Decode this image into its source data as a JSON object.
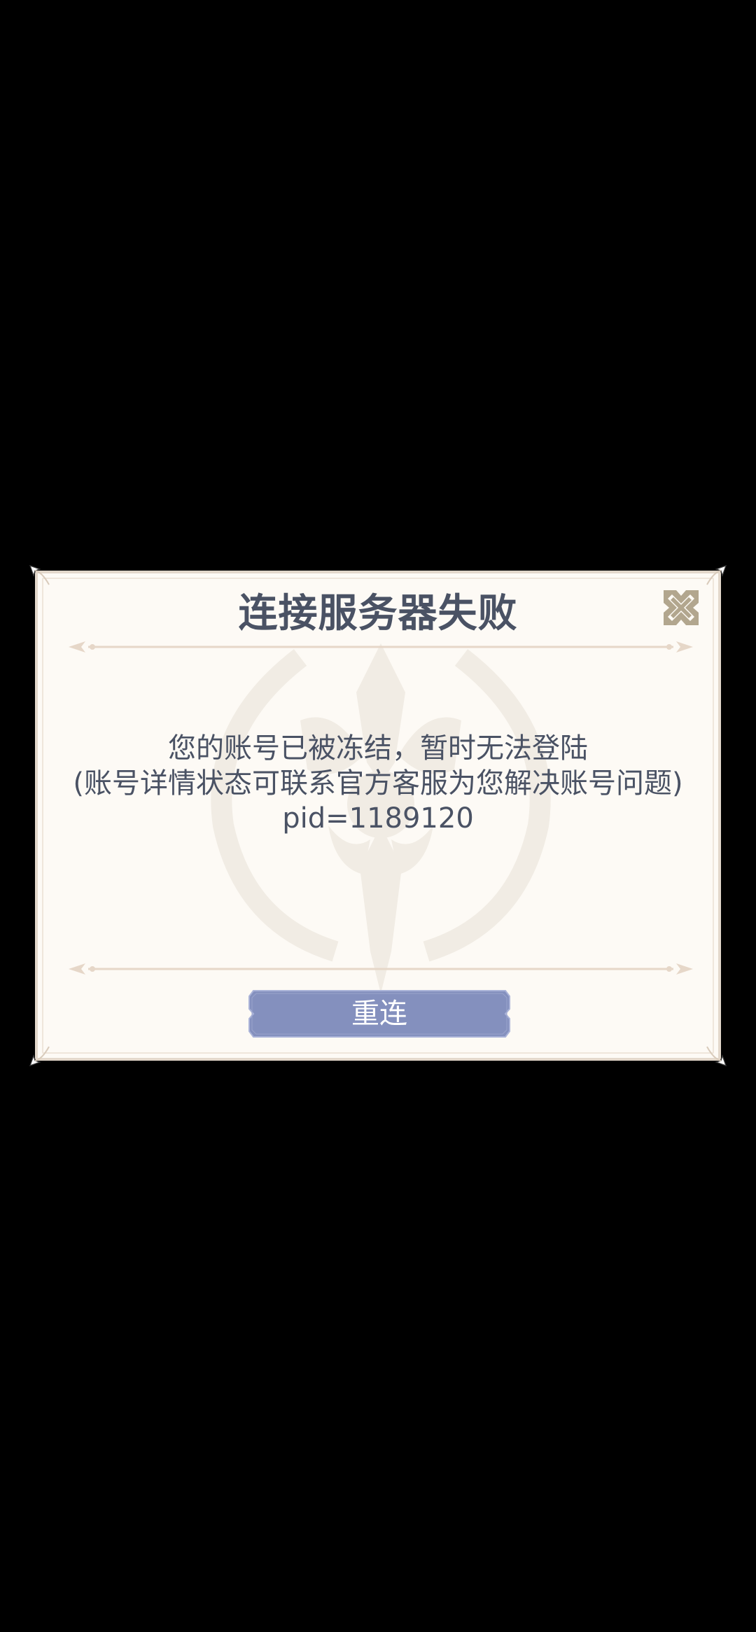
{
  "dialog": {
    "title": "连接服务器失败",
    "message_lines": [
      "您的账号已被冻结，暂时无法登陆",
      "(账号详情状态可联系官方客服为您解决账号问题)",
      "pid=1189120"
    ],
    "reconnect_label": "重连",
    "close_icon": "close-icon"
  },
  "colors": {
    "background": "#000000",
    "dialog_bg": "#fdfaf5",
    "text": "#4a5264",
    "button": "#8490be",
    "close_icon": "#b2a68e"
  }
}
